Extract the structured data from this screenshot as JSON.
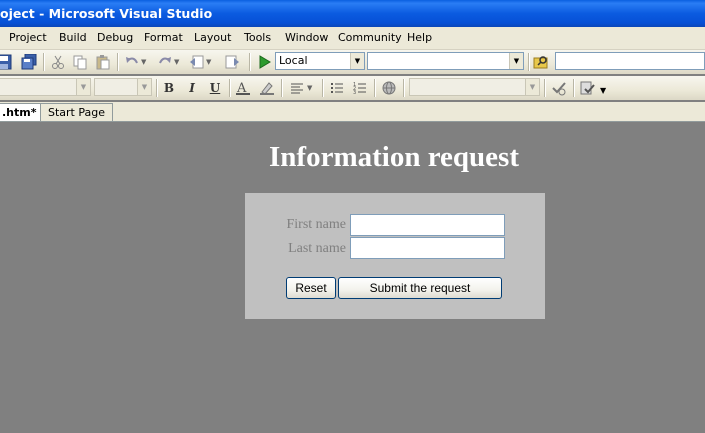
{
  "window": {
    "title": "oject - Microsoft Visual Studio"
  },
  "menu": [
    "Project",
    "Build",
    "Debug",
    "Format",
    "Layout",
    "Tools",
    "Window",
    "Community",
    "Help"
  ],
  "toolbar": {
    "solution_config": "Local",
    "platform_combo": "",
    "icons": [
      "save-icon",
      "save-all-icon",
      "cut-icon",
      "copy-icon",
      "paste-icon",
      "undo-icon",
      "redo-icon",
      "navigate-backward-icon",
      "navigate-forward-icon",
      "start-debugging-icon",
      "find-in-files-icon"
    ]
  },
  "format_toolbar": {
    "style_combo": "",
    "size_combo": "",
    "bold_glyph": "B",
    "italic_glyph": "I",
    "underline_glyph": "U",
    "target_combo": ""
  },
  "tabs": [
    {
      "label": ".htm*",
      "active": true
    },
    {
      "label": "Start Page",
      "active": false
    }
  ],
  "page": {
    "heading": "Information request",
    "form": {
      "first_name_label": "First name",
      "first_name_value": "",
      "last_name_label": "Last name",
      "last_name_value": "",
      "reset_label": "Reset",
      "submit_label": "Submit the request"
    }
  },
  "colors": {
    "title_bar": "#0a5fe0",
    "surface": "#808080",
    "form_background": "#c0c0c0",
    "label_text": "#808080",
    "heading_text": "#ffffff"
  }
}
